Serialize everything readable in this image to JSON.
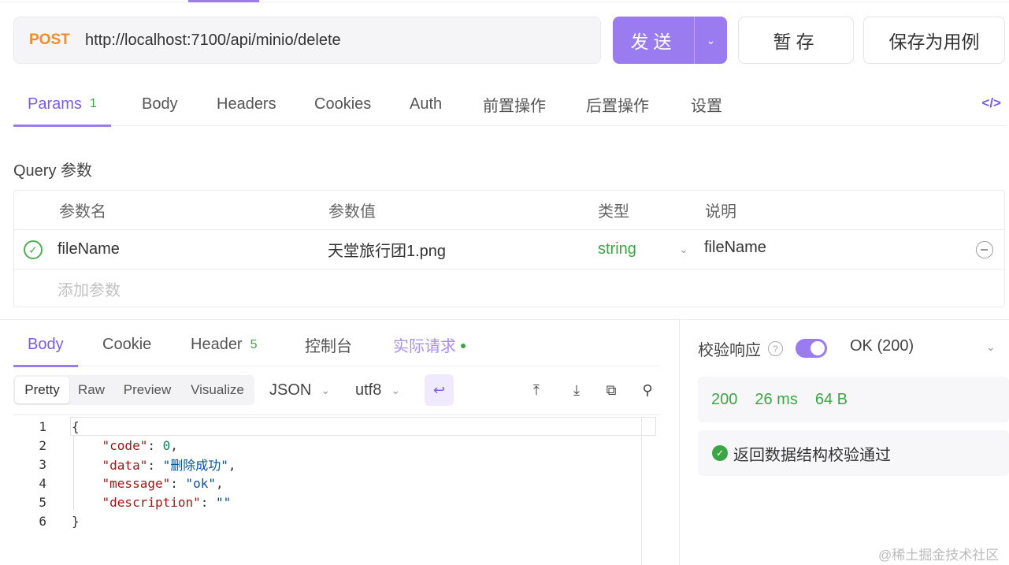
{
  "request": {
    "method": "POST",
    "url": "http://localhost:7100/api/minio/delete",
    "send_label": "发送",
    "save_label": "暂存",
    "save_example_label": "保存为用例"
  },
  "request_tabs": {
    "params": {
      "label": "Params",
      "count": "1"
    },
    "body": "Body",
    "headers": "Headers",
    "cookies": "Cookies",
    "auth": "Auth",
    "pre": "前置操作",
    "post": "后置操作",
    "settings": "设置"
  },
  "query": {
    "title": "Query 参数",
    "columns": {
      "name": "参数名",
      "value": "参数值",
      "type": "类型",
      "desc": "说明"
    },
    "rows": [
      {
        "name": "fileName",
        "value": "天堂旅行团1.png",
        "type": "string",
        "desc": "fileName"
      }
    ],
    "add_placeholder": "添加参数"
  },
  "response_tabs": {
    "body": "Body",
    "cookie": "Cookie",
    "header": {
      "label": "Header",
      "count": "5"
    },
    "console": "控制台",
    "actual": "实际请求"
  },
  "view": {
    "modes": [
      "Pretty",
      "Raw",
      "Preview",
      "Visualize"
    ],
    "format": "JSON",
    "encoding": "utf8"
  },
  "editor": {
    "line_numbers": [
      "1",
      "2",
      "3",
      "4",
      "5",
      "6"
    ]
  },
  "response_json": {
    "code": "0",
    "data": "删除成功",
    "message": "ok",
    "description": ""
  },
  "validation": {
    "label": "校验响应",
    "enabled": true,
    "status": "OK (200)",
    "status_code": "200",
    "time": "26 ms",
    "size": "64 B",
    "result": "返回数据结构校验通过"
  },
  "watermark": "@稀土掘金技术社区",
  "colors": {
    "accent": "#9a7cf0",
    "method": "#f08c2a",
    "success": "#3aa645"
  }
}
